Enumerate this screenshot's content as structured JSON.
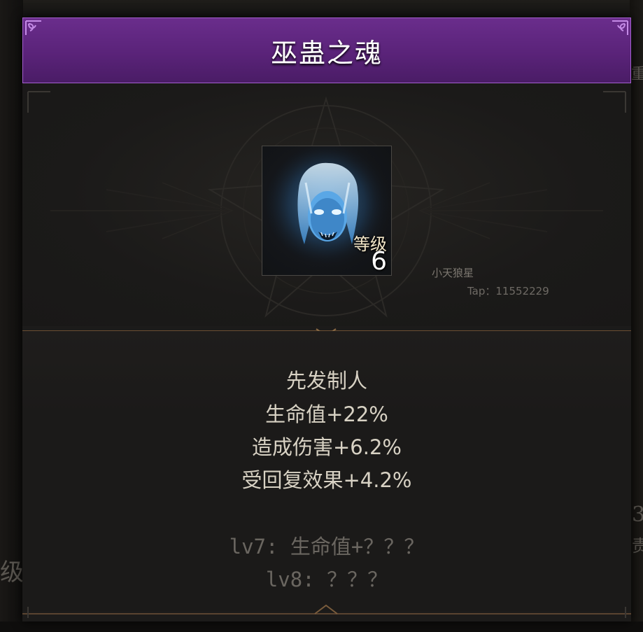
{
  "popup": {
    "title": "巫蛊之魂"
  },
  "item": {
    "level_label": "等级",
    "level_value": "6",
    "portrait_icon": "ghost-face-portrait"
  },
  "watermark": {
    "name": "小天狼星",
    "tap": "Tap：11552229"
  },
  "effects": {
    "name": "先发制人",
    "lines": [
      "生命值+22%",
      "造成伤害+6.2%",
      "受回复效果+4.2%"
    ]
  },
  "next_levels": [
    "lv7: 生命值+？？？",
    "lv8: ？？？"
  ],
  "background": {
    "left_char": "级",
    "right_char_1": "重",
    "right_char_2": "3",
    "right_char_3": "责"
  },
  "colors": {
    "title_bar": "#5a2379",
    "title_border": "#a55fd0",
    "panel": "#1b1a19",
    "effect_text": "#d8d2c4",
    "locked_text": "#6a6660"
  }
}
